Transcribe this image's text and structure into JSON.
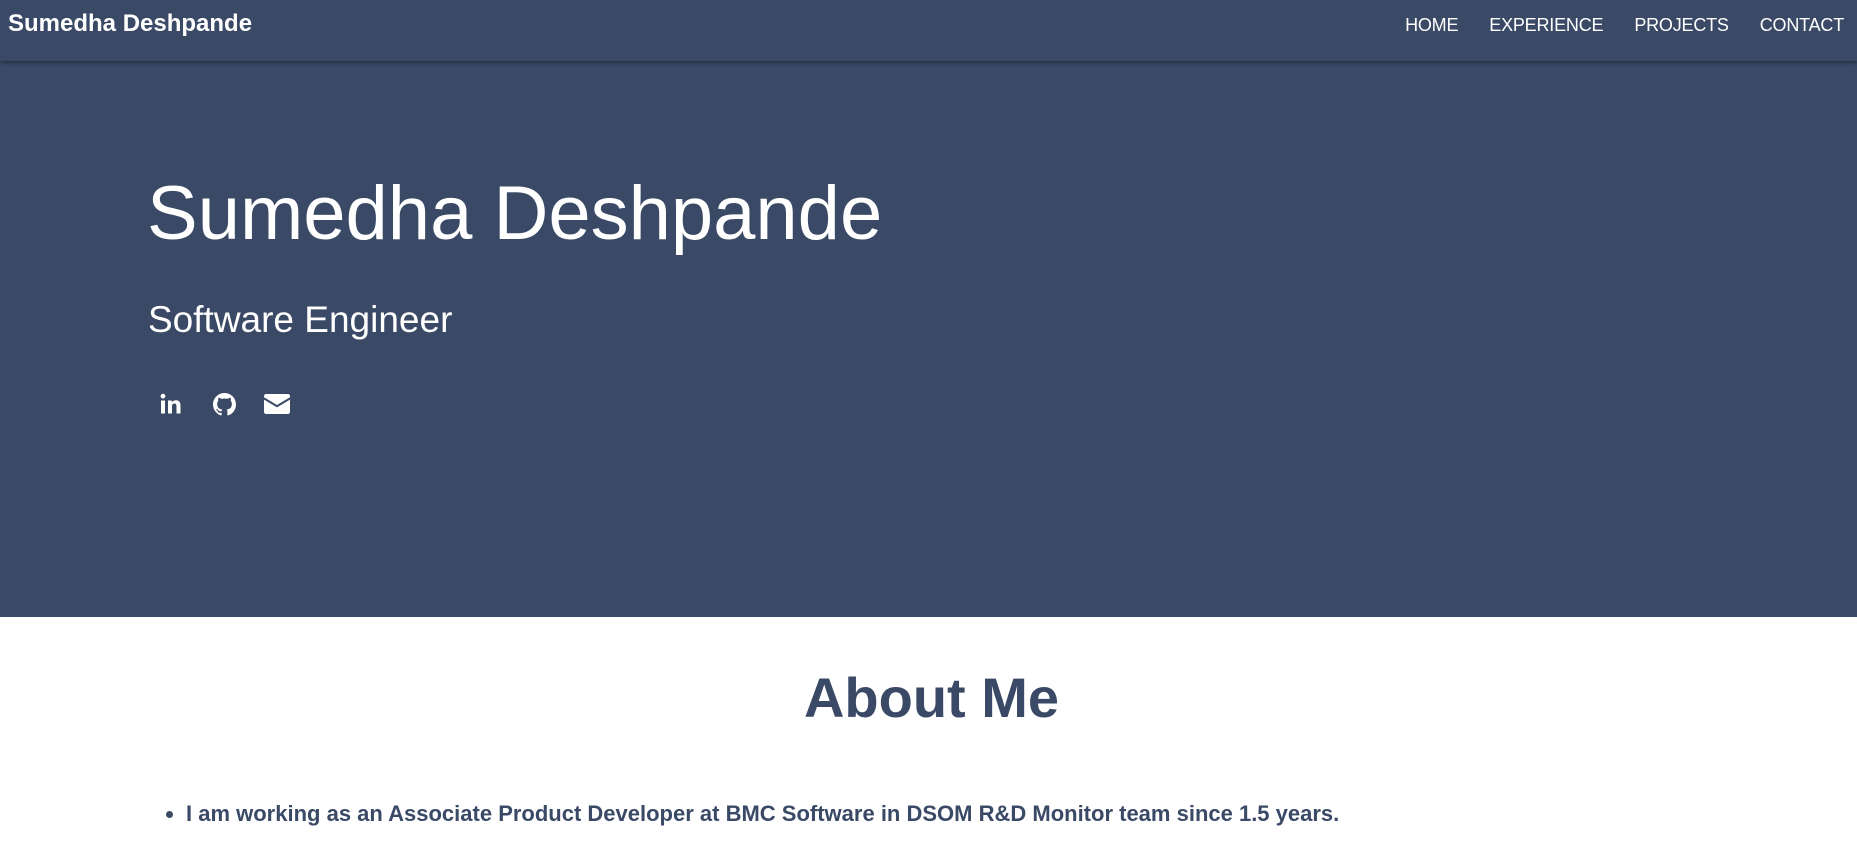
{
  "nav": {
    "brand": "Sumedha Deshpande",
    "links": [
      "HOME",
      "EXPERIENCE",
      "PROJECTS",
      "CONTACT"
    ]
  },
  "hero": {
    "name": "Sumedha Deshpande",
    "role": "Software Engineer",
    "socials": [
      {
        "icon": "linkedin-icon"
      },
      {
        "icon": "github-icon"
      },
      {
        "icon": "envelope-icon"
      }
    ]
  },
  "about": {
    "title": "About Me",
    "items": [
      "I am working as an Associate Product Developer at BMC Software in DSOM R&D Monitor team since 1.5 years."
    ]
  },
  "colors": {
    "primary": "#3a4966",
    "background": "#ffffff",
    "on_primary": "#ffffff"
  }
}
